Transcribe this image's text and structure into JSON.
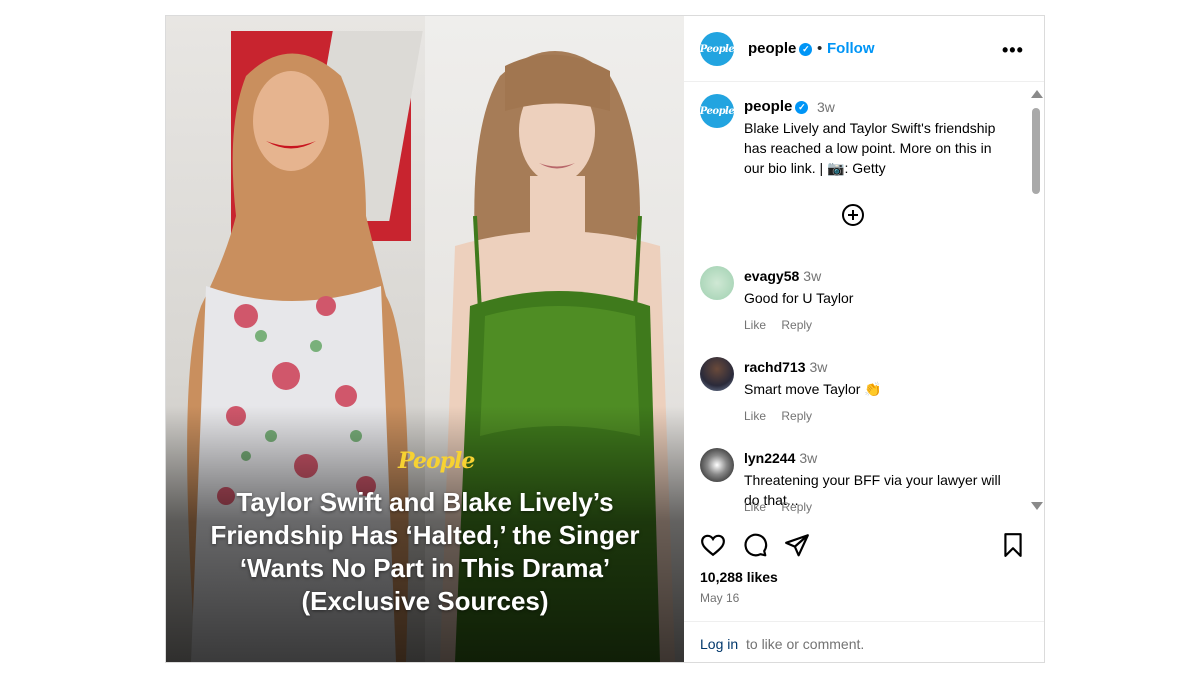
{
  "photo": {
    "brand": "People",
    "headline": "Taylor Swift and Blake Lively’s Friendship Has ‘Halted,’ the Singer ‘Wants No Part in This Drama’ (Exclusive Sources)"
  },
  "header": {
    "avatar_text": "People",
    "username": "people",
    "separator": "•",
    "follow_label": "Follow",
    "more_label": "•••"
  },
  "caption": {
    "avatar_text": "People",
    "username": "people",
    "time": "3w",
    "text": "Blake Lively and Taylor Swift's friendship has reached a low point. More on this in our bio link. | 📷: Getty"
  },
  "comments": [
    {
      "username": "evagy58",
      "time": "3w",
      "text": "Good for U Taylor",
      "like": "Like",
      "reply": "Reply"
    },
    {
      "username": "rachd713",
      "time": "3w",
      "text": "Smart move Taylor 👏",
      "like": "Like",
      "reply": "Reply"
    },
    {
      "username": "lyn2244",
      "time": "3w",
      "text": "Threatening your BFF via your lawyer will do that...",
      "like": "Like",
      "reply": "Reply"
    }
  ],
  "stats": {
    "likes": "10,288 likes",
    "date": "May 16"
  },
  "login": {
    "link": "Log in",
    "rest": "to like or comment."
  },
  "icons": [
    "heart-icon",
    "comment-icon",
    "share-icon",
    "bookmark-icon",
    "add-comment-icon",
    "verified-icon"
  ],
  "colors": {
    "accent": "#0095f6",
    "avatar": "#22a4e0",
    "brand_yellow": "#f7d232"
  }
}
